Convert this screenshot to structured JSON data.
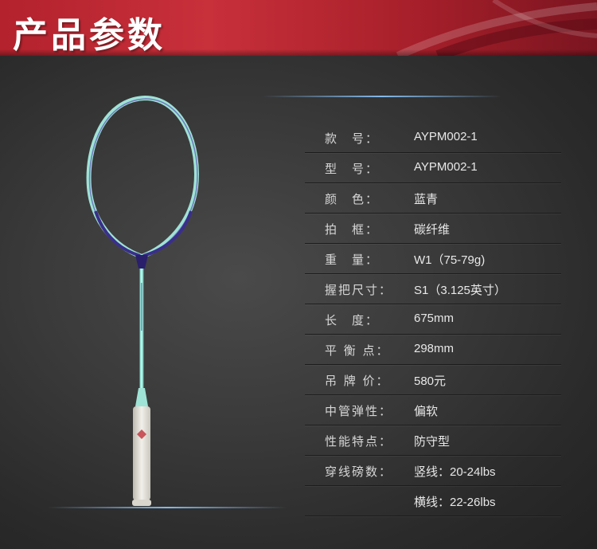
{
  "header": {
    "title": "产品参数"
  },
  "specs": [
    {
      "label": "款　号：",
      "value": "AYPM002-1"
    },
    {
      "label": "型　号：",
      "value": "AYPM002-1"
    },
    {
      "label": "颜　色：",
      "value": "蓝青"
    },
    {
      "label": "拍　框：",
      "value": "碳纤维"
    },
    {
      "label": "重　量：",
      "value": "W1（75-79g)"
    },
    {
      "label": "握把尺寸：",
      "value": "S1（3.125英寸）"
    },
    {
      "label": "长　度：",
      "value": "675mm"
    },
    {
      "label": "平 衡 点：",
      "value": "298mm"
    },
    {
      "label": "吊 牌 价：",
      "value": "580元"
    },
    {
      "label": "中管弹性：",
      "value": "偏软"
    },
    {
      "label": "性能特点：",
      "value": "防守型"
    },
    {
      "label": "穿线磅数：",
      "value": "竖线：20-24lbs"
    },
    {
      "label": "",
      "value": "横线：22-26lbs"
    }
  ],
  "colors": {
    "header_red": "#b3222d",
    "racket_frame": "#9fe3d6",
    "racket_throat": "#2a1f6b",
    "grip": "#e8e6df"
  }
}
